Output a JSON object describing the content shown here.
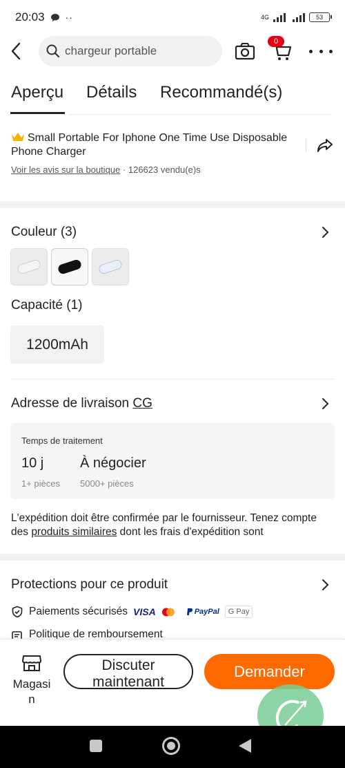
{
  "status_bar": {
    "time": "20:03",
    "network": "4G",
    "battery": "53"
  },
  "header": {
    "search_placeholder": "chargeur portable",
    "cart_badge": "0"
  },
  "tabs": [
    {
      "label": "Aperçu",
      "active": true
    },
    {
      "label": "Détails",
      "active": false
    },
    {
      "label": "Recommandé(s)",
      "active": false
    }
  ],
  "product": {
    "title": "Small Portable For Iphone One Time Use Disposable Phone Charger",
    "reviews_link": "Voir les avis sur la boutique",
    "separator": "·",
    "sold": "126623 vendu(e)s"
  },
  "color": {
    "title": "Couleur (3)",
    "swatches": [
      {
        "name": "white",
        "color": "#f4f4f4"
      },
      {
        "name": "black",
        "color": "#111111"
      },
      {
        "name": "white-blue",
        "color": "#e9eef8"
      }
    ]
  },
  "capacity": {
    "title": "Capacité (1)",
    "option": "1200mAh"
  },
  "delivery": {
    "title": "Adresse de livraison",
    "country_code": "CG",
    "card_label": "Temps de traitement",
    "columns": [
      {
        "value": "10 j",
        "sub": "1+ pièces"
      },
      {
        "value": "À négocier",
        "sub": "5000+ pièces"
      }
    ],
    "note_before": "L'expédition doit être confirmée par le fournisseur. Tenez compte des ",
    "note_link": "produits similaires",
    "note_after": " dont les frais d'expédition sont"
  },
  "protections": {
    "title": "Protections pour ce produit",
    "secure_payments": "Paiements sécurisés",
    "payment_logos": [
      "VISA",
      "PayPal",
      "G Pay"
    ],
    "refund_policy": "Politique de remboursement"
  },
  "bottom_bar": {
    "store_label": "Magasin",
    "chat_label": "Discuter maintenant",
    "inquire_label": "Demander"
  },
  "colors": {
    "accent": "#ff6a00",
    "badge": "#e60012",
    "text": "#222222"
  }
}
